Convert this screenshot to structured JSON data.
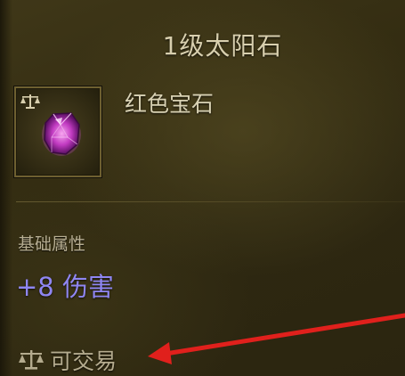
{
  "item": {
    "name": "1级太阳石",
    "type": "红色宝石",
    "icon": "red-gem-icon"
  },
  "stats": {
    "section_label": "基础属性",
    "line": "+8 伤害"
  },
  "trade": {
    "icon": "scales-icon",
    "label": "可交易"
  },
  "colors": {
    "title": "#d8cfae",
    "stat": "#8f86f2",
    "arrow": "#e0201c"
  }
}
